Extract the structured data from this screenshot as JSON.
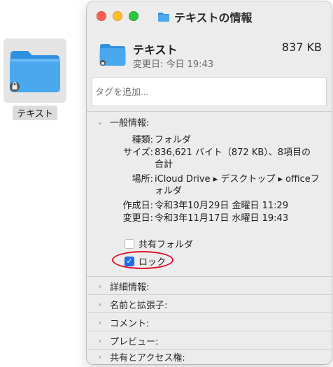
{
  "desktop": {
    "folder_label": "テキスト"
  },
  "window": {
    "title": "テキストの情報",
    "traffic_lights": [
      "close",
      "minimize",
      "zoom"
    ],
    "colors": {
      "close": "#fe5f57",
      "minimize": "#febc2e",
      "zoom": "#28c840",
      "accent": "#1f6df2",
      "annotation": "#e1102a",
      "folder": "#4aa8ef"
    }
  },
  "summary": {
    "name": "テキスト",
    "size": "837 KB",
    "modified": "変更日: 今日 19:43"
  },
  "tags": {
    "placeholder": "タグを追加..."
  },
  "general": {
    "header": "一般情報:",
    "kind_key": "種類:",
    "kind_value": "フォルダ",
    "size_key": "サイズ:",
    "size_value_line1": "836,621 バイト（872 KB）、8項目の",
    "size_value_line2": "合計",
    "where_key": "場所:",
    "where_value_line1": "iCloud Drive ▸ デスクトップ ▸ officeフ",
    "where_value_line2": "ォルダ",
    "created_key": "作成日:",
    "created_value": "令和3年10月29日 金曜日 11:29",
    "modified_key": "変更日:",
    "modified_value": "令和3年11月17日 水曜日 19:43",
    "shared_folder_label": "共有フォルダ",
    "shared_folder_checked": false,
    "locked_label": "ロック",
    "locked_checked": true
  },
  "sections": {
    "more_info": "詳細情報:",
    "name_ext": "名前と拡張子:",
    "comments": "コメント:",
    "preview": "プレビュー:",
    "sharing": "共有とアクセス権:"
  },
  "icons": {
    "chevron_expanded": "chevron-down-icon",
    "chevron_collapsed": "chevron-right-icon",
    "checkmark": "✓"
  }
}
